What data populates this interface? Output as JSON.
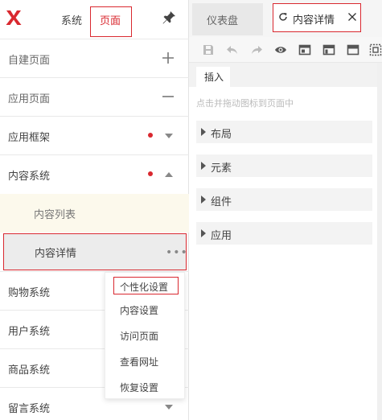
{
  "header": {
    "tabs": [
      {
        "label": "系统"
      },
      {
        "label": "页面"
      }
    ]
  },
  "sidebar": {
    "items": [
      {
        "label": "自建页面",
        "control": "plus-icon"
      },
      {
        "label": "应用页面",
        "control": "minus-icon"
      },
      {
        "label": "应用框架",
        "control": "caret-down-icon",
        "badge": true
      },
      {
        "label": "内容系统",
        "control": "caret-up-icon",
        "badge": true
      },
      {
        "label": "内容列表"
      },
      {
        "label": "内容详情",
        "more": "•••"
      },
      {
        "label": "购物系统"
      },
      {
        "label": "用户系统"
      },
      {
        "label": "商品系统"
      },
      {
        "label": "留言系统",
        "control": "caret-down-icon"
      }
    ]
  },
  "context_menu": {
    "items": [
      {
        "label": "个性化设置"
      },
      {
        "label": "内容设置"
      },
      {
        "label": "访问页面"
      },
      {
        "label": "查看网址"
      },
      {
        "label": "恢复设置"
      }
    ]
  },
  "workspace": {
    "tabs": [
      {
        "label": "仪表盘"
      },
      {
        "label": "内容详情"
      }
    ],
    "toolbar_icons": [
      "save-icon",
      "undo-icon",
      "redo-icon",
      "preview-icon",
      "layout-icon",
      "header-layout-icon",
      "full-layout-icon",
      "grid-icon"
    ],
    "insert_tab": "插入",
    "hint": "点击并拖动图标到页面中",
    "sections": [
      {
        "label": "布局"
      },
      {
        "label": "元素"
      },
      {
        "label": "组件"
      },
      {
        "label": "应用"
      }
    ]
  },
  "colors": {
    "accent": "#d9282f",
    "active_row_bg": "#fcf9ec",
    "selected_row_bg": "#ececec"
  }
}
